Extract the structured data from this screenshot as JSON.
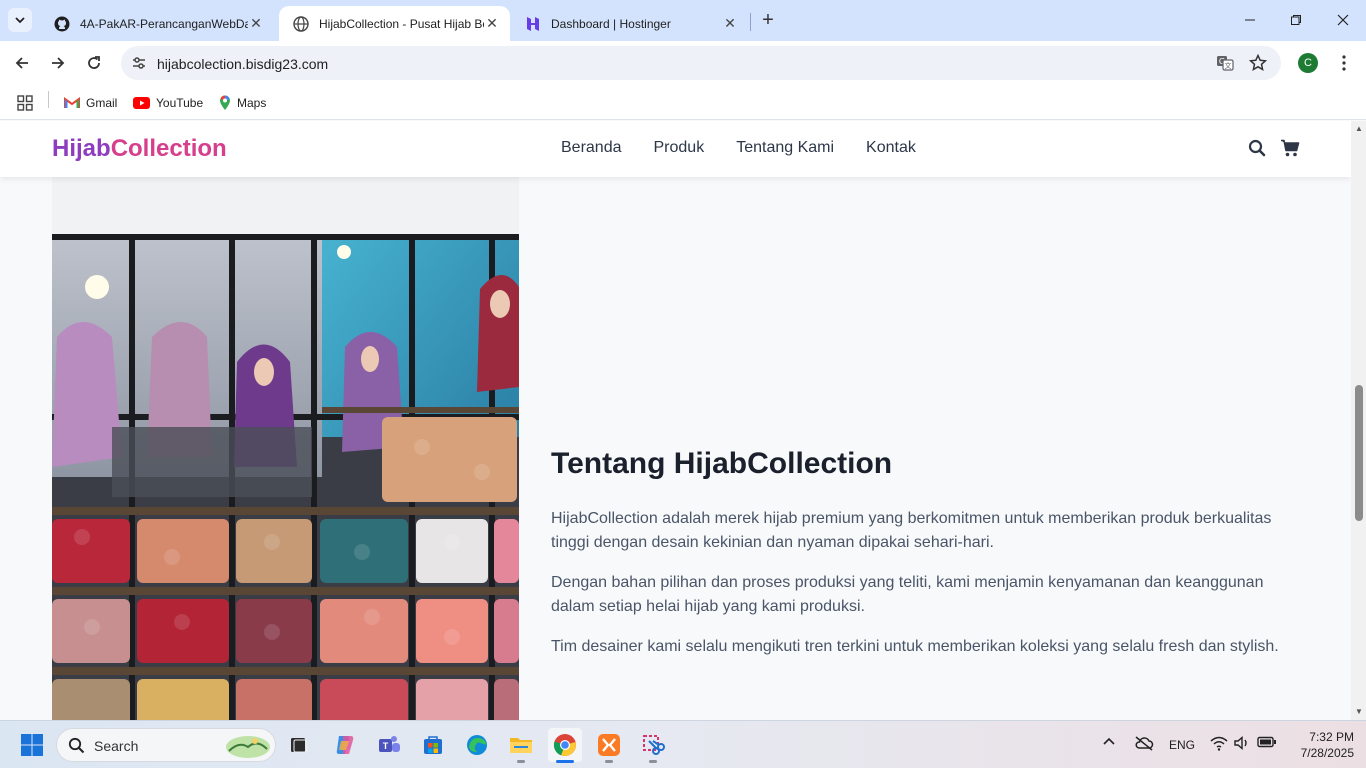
{
  "browser": {
    "tabs": [
      {
        "title": "4A-PakAR-PerancanganWebDa",
        "icon": "github-icon",
        "active": false
      },
      {
        "title": "HijabCollection - Pusat Hijab Be",
        "icon": "globe-icon",
        "active": true
      },
      {
        "title": "Dashboard | Hostinger",
        "icon": "hostinger-icon",
        "active": false
      }
    ],
    "new_tab": "+",
    "url": "hijabcolection.bisdig23.com",
    "profile_initial": "C",
    "bookmarks": [
      {
        "label": "Gmail",
        "icon": "gmail-icon"
      },
      {
        "label": "YouTube",
        "icon": "youtube-icon"
      },
      {
        "label": "Maps",
        "icon": "maps-icon"
      }
    ]
  },
  "site": {
    "logo_part1": "Hijab",
    "logo_part2": "Collection",
    "nav": [
      "Beranda",
      "Produk",
      "Tentang Kami",
      "Kontak"
    ],
    "about": {
      "heading": "Tentang HijabCollection",
      "paragraphs": [
        "HijabCollection adalah merek hijab premium yang berkomitmen untuk memberikan produk berkualitas tinggi dengan desain kekinian dan nyaman dipakai sehari-hari.",
        "Dengan bahan pilihan dan proses produksi yang teliti, kami menjamin kenyamanan dan keanggunan dalam setiap helai hijab yang kami produksi.",
        "Tim desainer kami selalu mengikuti tren terkini untuk memberikan koleksi yang selalu fresh dan stylish."
      ]
    },
    "colors": {
      "brand_purple": "#8e3dbf",
      "brand_pink": "#d53f8c"
    }
  },
  "taskbar": {
    "search_label": "Search",
    "language": "ENG",
    "time": "7:32 PM",
    "date": "7/28/2025"
  }
}
